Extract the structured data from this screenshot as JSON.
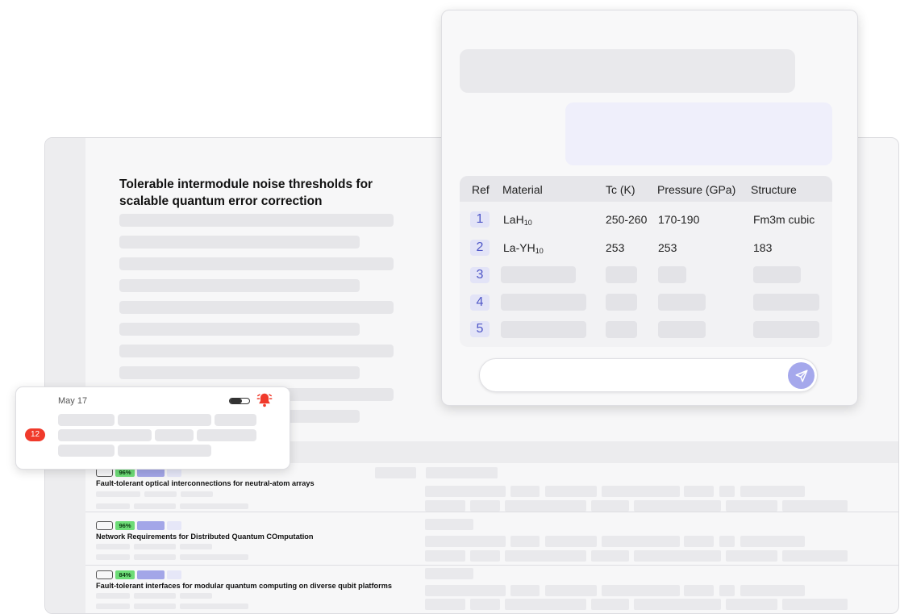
{
  "document": {
    "title": "Tolerable intermodule noise thresholds for scalable quantum error correction"
  },
  "results": {
    "rows": [
      {
        "score": "96%",
        "title": "Fault-tolerant optical interconnections for neutral-atom arrays"
      },
      {
        "score": "96%",
        "title": "Network Requirements for Distributed Quantum COmputation"
      },
      {
        "score": "84%",
        "title": "Fault-tolerant interfaces for modular quantum computing on diverse qubit platforms"
      }
    ],
    "score_color": "#6ddc77",
    "tag_color": "#a3a6e8"
  },
  "chat": {
    "table": {
      "headers": [
        "Ref",
        "Material",
        "Tc (K)",
        "Pressure (GPa)",
        "Structure"
      ],
      "rows": [
        {
          "ref": "1",
          "material": "LaH",
          "material_sub": "10",
          "tc": "250-260",
          "pressure": "170-190",
          "structure": "Fm3m cubic"
        },
        {
          "ref": "2",
          "material": "La-YH",
          "material_sub": "10",
          "tc": "253",
          "pressure": "253",
          "structure": "183"
        },
        {
          "ref": "3"
        },
        {
          "ref": "4"
        },
        {
          "ref": "5"
        }
      ]
    },
    "send_icon": "send-icon",
    "accent": "#a5a8ec"
  },
  "notification": {
    "date": "May 17",
    "count": "12",
    "icon": "bell-icon",
    "alert_color": "#f03a2b"
  }
}
